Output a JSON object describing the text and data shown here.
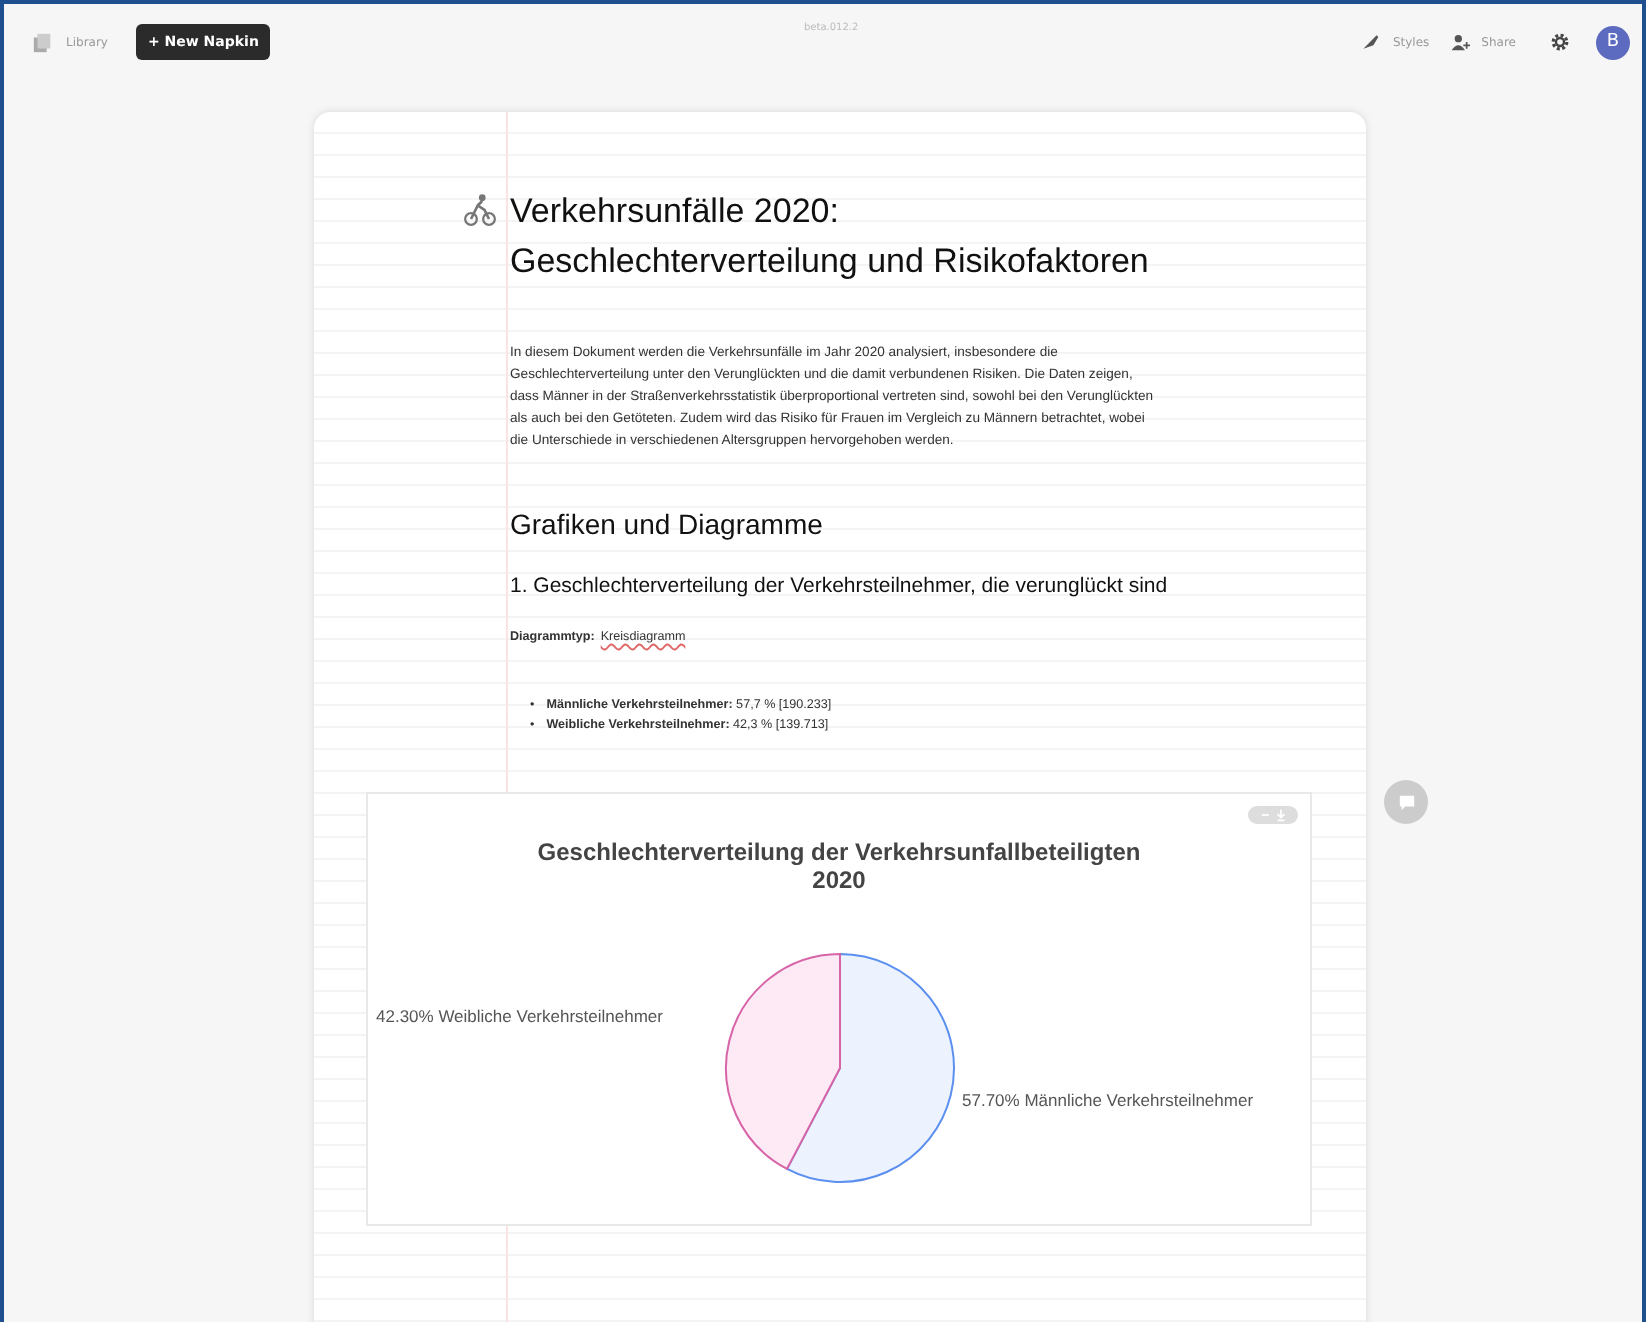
{
  "topbar": {
    "library": "Library",
    "new_button": "+ New Napkin",
    "version": "beta.012.2",
    "styles": "Styles",
    "share": "Share",
    "avatar": "B"
  },
  "document": {
    "title_lines": [
      "Verkehrsunfälle 2020:",
      "Geschlechterverteilung und Risikofaktoren"
    ],
    "intro": "In diesem Dokument werden die Verkehrsunfälle im Jahr 2020 analysiert, insbesondere die Geschlechterverteilung unter den Verunglückten und die damit verbundenen Risiken. Die Daten zeigen, dass Männer in der Straßenverkehrsstatistik überproportional vertreten sind, sowohl bei den Verunglückten als auch bei den Getöteten. Zudem wird das Risiko für Frauen im Vergleich zu Männern betrachtet, wobei die Unterschiede in verschiedenen Altersgruppen hervorgehoben werden.",
    "section": "Grafiken und Diagramme",
    "subsection": "1. Geschlechterverteilung der Verkehrsteilnehmer, die verunglückt sind",
    "type_label": "Diagrammtyp:",
    "type_value": "Kreisdiagramm",
    "bullets": [
      {
        "marker": "•",
        "text": "**Männliche Verkehrsteilnehmer:** 57,7 % [190.233]"
      },
      {
        "marker": "•",
        "text": "**Weibliche Verkehrsteilnehmer:** 42,3 % [139.713]"
      }
    ],
    "chart": {
      "chart_data": {
        "type": "pie",
        "title": "Geschlechterverteilung der Verkehrsunfallbeteiligten 2020",
        "categories": [
          "Männliche Verkehrsteilnehmer",
          "Weibliche Verkehrsteilnehmer"
        ],
        "values": [
          57.7,
          42.3
        ],
        "value_labels": [
          "57.70%",
          "42.30%"
        ]
      }
    }
  }
}
